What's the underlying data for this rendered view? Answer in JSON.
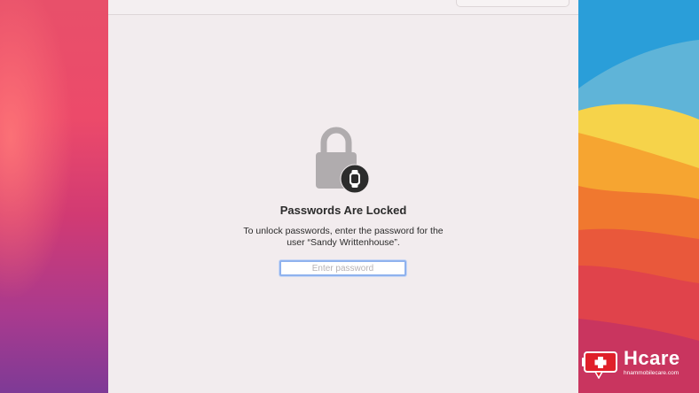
{
  "lock_screen": {
    "title": "Passwords Are Locked",
    "description": "To unlock passwords, enter the password for the user “Sandy Writtenhouse”.",
    "password_placeholder": "Enter password",
    "password_value": ""
  },
  "icons": {
    "lock": "lock-icon",
    "badge": "apple-watch-icon"
  },
  "watermark": {
    "brand": "Hcare",
    "url": "hnammobilecare.com"
  },
  "colors": {
    "window_bg": "#f2ecee",
    "focus_ring": "#8fb2ee",
    "lock_gray": "#b0acae",
    "brand_red": "#e0202a"
  }
}
